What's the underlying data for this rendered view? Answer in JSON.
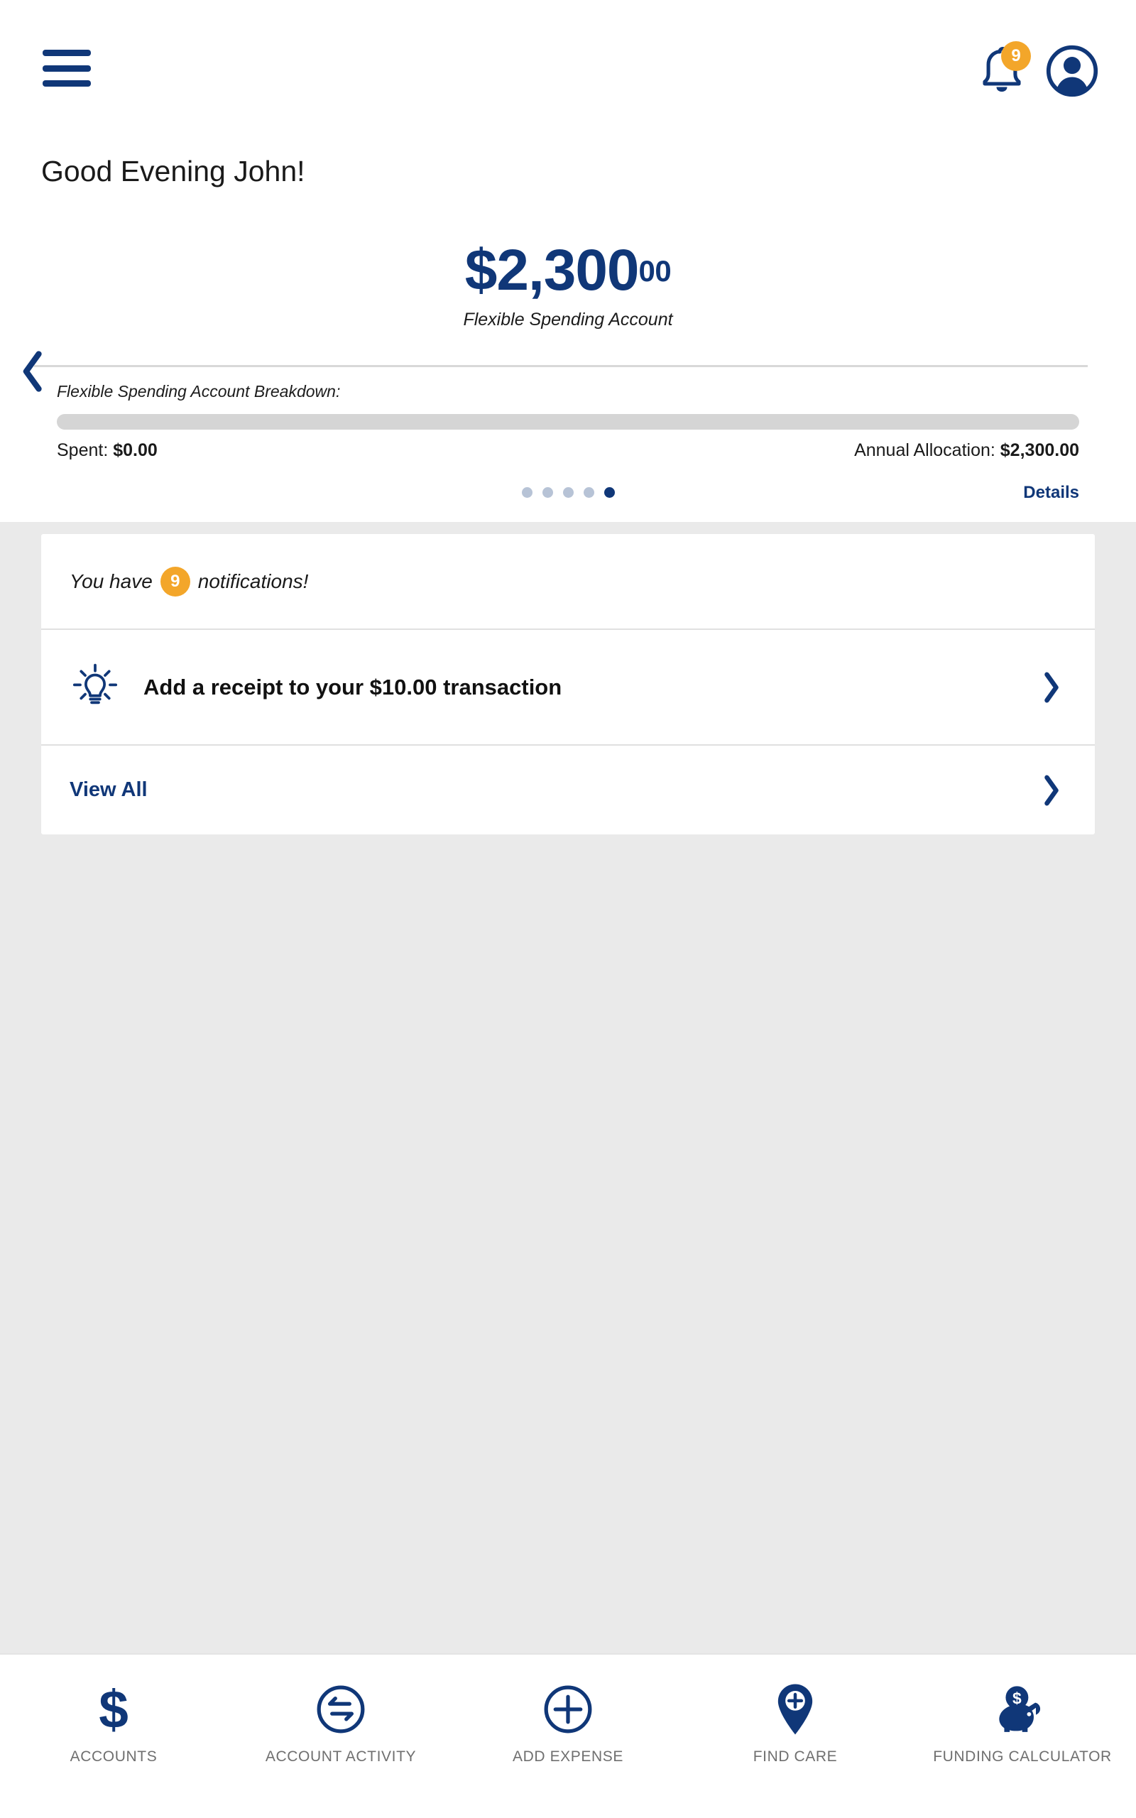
{
  "colors": {
    "brand_blue": "#103778",
    "accent_orange": "#f3a62a",
    "page_background": "#eaeaea",
    "card_background": "#ffffff",
    "muted_text": "#6f6f6f",
    "track_gray": "#d5d5d5"
  },
  "header": {
    "menu_icon": "hamburger-menu-icon",
    "bell_icon": "notification-bell-icon",
    "bell_badge_count": "9",
    "avatar_icon": "user-avatar-icon"
  },
  "greeting": {
    "text": "Good Evening John!"
  },
  "balance_card": {
    "amount_dollars": "$2,300",
    "amount_cents": "00",
    "account_label": "Flexible Spending Account",
    "prev_arrow_icon": "chevron-left-icon",
    "breakdown_label": "Flexible Spending Account Breakdown:",
    "progress_percent": 0,
    "spent_prefix": "Spent: ",
    "spent_value": "$0.00",
    "allocation_prefix": "Annual Allocation: ",
    "allocation_value": "$2,300.00",
    "details_label": "Details",
    "carousel": {
      "total_dots": 5,
      "active_index": 4
    }
  },
  "notifications_card": {
    "count_prefix": "You have",
    "count": "9",
    "count_suffix": "notifications!",
    "tip": {
      "icon": "lightbulb-icon",
      "text": "Add a receipt to your $10.00 transaction",
      "chevron_icon": "chevron-right-icon"
    },
    "view_all": {
      "label": "View All",
      "chevron_icon": "chevron-right-icon"
    }
  },
  "bottom_nav": {
    "items": [
      {
        "label": "ACCOUNTS",
        "icon": "dollar-sign-icon"
      },
      {
        "label": "ACCOUNT ACTIVITY",
        "icon": "transfer-arrows-circle-icon"
      },
      {
        "label": "ADD EXPENSE",
        "icon": "plus-circle-icon"
      },
      {
        "label": "FIND CARE",
        "icon": "map-pin-plus-icon"
      },
      {
        "label": "FUNDING CALCULATOR",
        "icon": "piggy-bank-icon"
      }
    ]
  }
}
